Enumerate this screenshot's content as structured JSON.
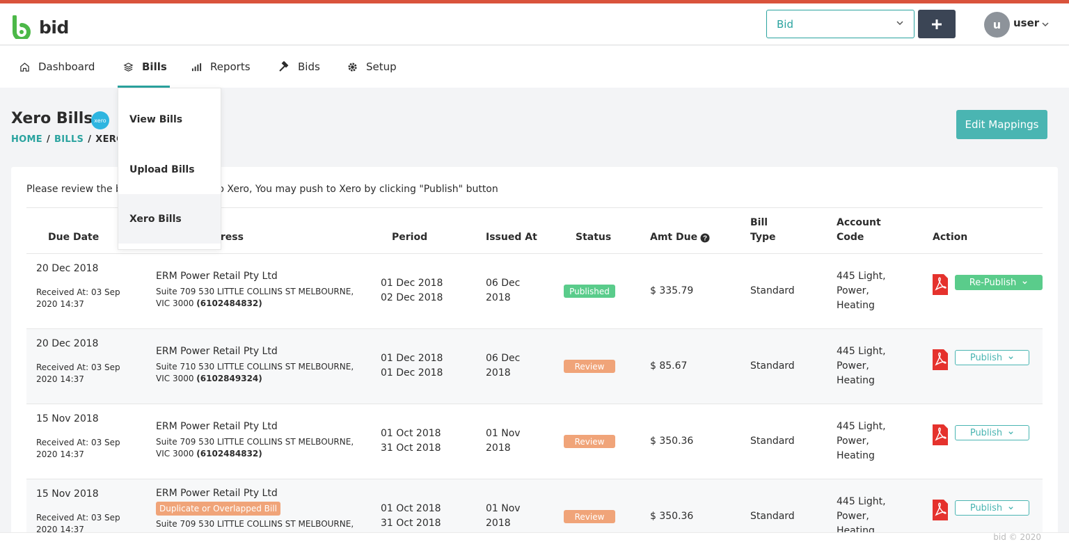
{
  "header": {
    "logo_text": "bid",
    "bid_select_value": "Bid",
    "user_initial": "u",
    "user_name": "user",
    "accent_color": "#d9533c",
    "brand_color": "#2aa39f"
  },
  "nav": {
    "items": [
      {
        "label": "Dashboard",
        "icon": "home-icon"
      },
      {
        "label": "Bills",
        "icon": "layers-icon"
      },
      {
        "label": "Reports",
        "icon": "bar-chart-icon"
      },
      {
        "label": "Bids",
        "icon": "gavel-icon"
      },
      {
        "label": "Setup",
        "icon": "gear-icon"
      }
    ],
    "active": "Bills"
  },
  "bills_menu": {
    "items": [
      "View Bills",
      "Upload Bills",
      "Xero Bills"
    ],
    "selected": "Xero Bills"
  },
  "page": {
    "title": "Xero Bills",
    "xero_badge": "xero",
    "breadcrumb": [
      "HOME",
      "BILLS",
      "XERO BILLS"
    ],
    "edit_button": "Edit Mappings",
    "intro": "Please review the bills before pushing to Xero, You may push to Xero by clicking \"Publish\" button"
  },
  "table": {
    "headers": {
      "due_date": "Due Date",
      "address": "Address",
      "period": "Period",
      "issued_at": "Issued At",
      "status": "Status",
      "amt_due": "Amt Due",
      "bill_type_1": "Bill",
      "bill_type_2": "Type",
      "account_code_1": "Account",
      "account_code_2": "Code",
      "action": "Action"
    },
    "rows": [
      {
        "due_date": "20 Dec 2018",
        "received_1": "Received At: 03 Sep",
        "received_2": "2020 14:37",
        "company": "ERM Power Retail Pty Ltd",
        "badge": "",
        "addr_1": "Suite 709 530 LITTLE COLLINS ST MELBOURNE,",
        "addr_2": "VIC 3000 ",
        "nmi": "(6102484832)",
        "period_start": "01 Dec 2018",
        "period_end": "02 Dec 2018",
        "issued_1": "06 Dec",
        "issued_2": "2018",
        "status": "Published",
        "amount": "$ 335.79",
        "bill_type": "Standard",
        "acct_1": "445 Light,",
        "acct_2": "Power,",
        "acct_3": "Heating",
        "action": "Re-Publish"
      },
      {
        "due_date": "20 Dec 2018",
        "received_1": "Received At: 03 Sep",
        "received_2": "2020 14:37",
        "company": "ERM Power Retail Pty Ltd",
        "badge": "",
        "addr_1": "Suite 710 530 LITTLE COLLINS ST MELBOURNE,",
        "addr_2": "VIC 3000 ",
        "nmi": "(6102849324)",
        "period_start": "01 Dec 2018",
        "period_end": "01 Dec 2018",
        "issued_1": "06 Dec",
        "issued_2": "2018",
        "status": "Review",
        "amount": "$ 85.67",
        "bill_type": "Standard",
        "acct_1": "445 Light,",
        "acct_2": "Power,",
        "acct_3": "Heating",
        "action": "Publish"
      },
      {
        "due_date": "15 Nov 2018",
        "received_1": "Received At: 03 Sep",
        "received_2": "2020 14:37",
        "company": "ERM Power Retail Pty Ltd",
        "badge": "",
        "addr_1": "Suite 709 530 LITTLE COLLINS ST MELBOURNE,",
        "addr_2": "VIC 3000 ",
        "nmi": "(6102484832)",
        "period_start": "01 Oct 2018",
        "period_end": "31 Oct 2018",
        "issued_1": "01 Nov",
        "issued_2": "2018",
        "status": "Review",
        "amount": "$ 350.36",
        "bill_type": "Standard",
        "acct_1": "445 Light,",
        "acct_2": "Power,",
        "acct_3": "Heating",
        "action": "Publish"
      },
      {
        "due_date": "15 Nov 2018",
        "received_1": "Received At: 03 Sep",
        "received_2": "2020 14:37",
        "company": "ERM Power Retail Pty Ltd",
        "badge": "Duplicate or Overlapped Bill",
        "addr_1": "Suite 709 530 LITTLE COLLINS ST MELBOURNE,",
        "addr_2": "",
        "nmi": "",
        "period_start": "01 Oct 2018",
        "period_end": "31 Oct 2018",
        "issued_1": "01 Nov",
        "issued_2": "2018",
        "status": "Review",
        "amount": "$ 350.36",
        "bill_type": "Standard",
        "acct_1": "445 Light,",
        "acct_2": "Power,",
        "acct_3": "Heating",
        "action": "Publish"
      }
    ]
  },
  "footer": {
    "right": "bid © 2020"
  }
}
